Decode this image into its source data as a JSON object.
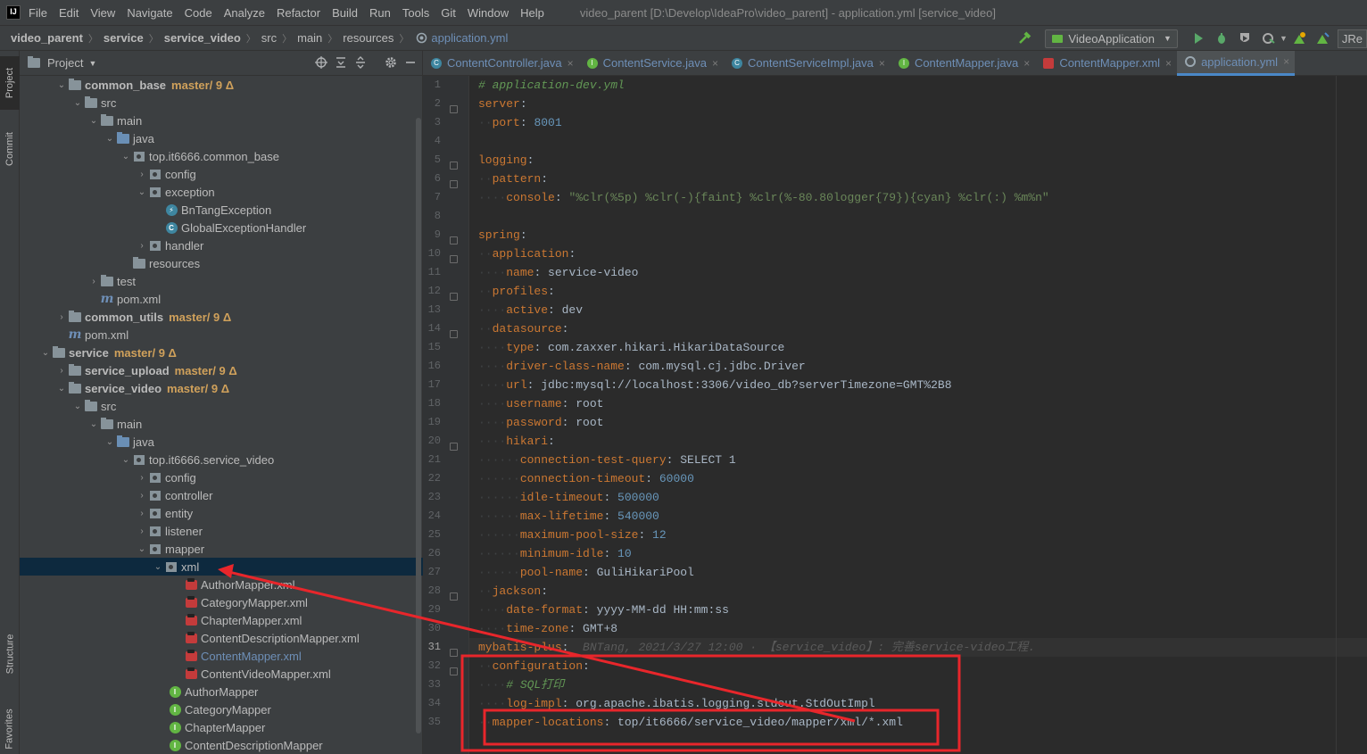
{
  "menubar": {
    "items": [
      "File",
      "Edit",
      "View",
      "Navigate",
      "Code",
      "Analyze",
      "Refactor",
      "Build",
      "Run",
      "Tools",
      "Git",
      "Window",
      "Help"
    ],
    "window_title": "video_parent [D:\\Develop\\IdeaPro\\video_parent] - application.yml [service_video]"
  },
  "navbar": {
    "breadcrumbs": [
      "video_parent",
      "service",
      "service_video",
      "src",
      "main",
      "resources",
      "application.yml"
    ],
    "run_config": "VideoApplication",
    "jre_label": "JRe"
  },
  "left_strip": {
    "project": "Project",
    "commit": "Commit",
    "structure": "Structure",
    "favorites": "Favorites"
  },
  "project_panel": {
    "title": "Project",
    "tree": [
      {
        "name": "common_base",
        "vcs": "master/ 9 Δ"
      },
      {
        "name": "src"
      },
      {
        "name": "main"
      },
      {
        "name": "java"
      },
      {
        "name": "top.it6666.common_base"
      },
      {
        "name": "config"
      },
      {
        "name": "exception"
      },
      {
        "name": "BnTangException"
      },
      {
        "name": "GlobalExceptionHandler"
      },
      {
        "name": "handler"
      },
      {
        "name": "resources"
      },
      {
        "name": "test"
      },
      {
        "name": "pom.xml"
      },
      {
        "name": "common_utils",
        "vcs": "master/ 9 Δ"
      },
      {
        "name": "pom.xml"
      },
      {
        "name": "service",
        "vcs": "master/ 9 Δ"
      },
      {
        "name": "service_upload",
        "vcs": "master/ 9 Δ"
      },
      {
        "name": "service_video",
        "vcs": "master/ 9 Δ"
      },
      {
        "name": "src"
      },
      {
        "name": "main"
      },
      {
        "name": "java"
      },
      {
        "name": "top.it6666.service_video"
      },
      {
        "name": "config"
      },
      {
        "name": "controller"
      },
      {
        "name": "entity"
      },
      {
        "name": "listener"
      },
      {
        "name": "mapper"
      },
      {
        "name": "xml"
      },
      {
        "name": "AuthorMapper.xml"
      },
      {
        "name": "CategoryMapper.xml"
      },
      {
        "name": "ChapterMapper.xml"
      },
      {
        "name": "ContentDescriptionMapper.xml"
      },
      {
        "name": "ContentMapper.xml"
      },
      {
        "name": "ContentVideoMapper.xml"
      },
      {
        "name": "AuthorMapper"
      },
      {
        "name": "CategoryMapper"
      },
      {
        "name": "ChapterMapper"
      },
      {
        "name": "ContentDescriptionMapper"
      }
    ]
  },
  "editor": {
    "tabs": [
      "ContentController.java",
      "ContentService.java",
      "ContentServiceImpl.java",
      "ContentMapper.java",
      "ContentMapper.xml",
      "application.yml"
    ],
    "active_tab": "application.yml",
    "current_line": 31,
    "lines": [
      {
        "t": [
          [
            "c",
            "# application-dev.yml"
          ]
        ]
      },
      {
        "t": [
          [
            "k",
            "server"
          ],
          [
            "v",
            ":"
          ]
        ]
      },
      {
        "t": [
          [
            "d",
            "  "
          ],
          [
            "k",
            "port"
          ],
          [
            "v",
            ": "
          ],
          [
            "n",
            "8001"
          ]
        ]
      },
      {
        "t": []
      },
      {
        "t": [
          [
            "k",
            "logging"
          ],
          [
            "v",
            ":"
          ]
        ]
      },
      {
        "t": [
          [
            "d",
            "  "
          ],
          [
            "k",
            "pattern"
          ],
          [
            "v",
            ":"
          ]
        ]
      },
      {
        "t": [
          [
            "d",
            "    "
          ],
          [
            "k",
            "console"
          ],
          [
            "v",
            ": "
          ],
          [
            "s",
            "\"%clr(%5p) %clr(-){faint} %clr(%-80.80logger{79}){cyan} %clr(:) %m%n\""
          ]
        ]
      },
      {
        "t": []
      },
      {
        "t": [
          [
            "k",
            "spring"
          ],
          [
            "v",
            ":"
          ]
        ]
      },
      {
        "t": [
          [
            "d",
            "  "
          ],
          [
            "k",
            "application"
          ],
          [
            "v",
            ":"
          ]
        ]
      },
      {
        "t": [
          [
            "d",
            "    "
          ],
          [
            "k",
            "name"
          ],
          [
            "v",
            ": service-video"
          ]
        ]
      },
      {
        "t": [
          [
            "d",
            "  "
          ],
          [
            "k",
            "profiles"
          ],
          [
            "v",
            ":"
          ]
        ]
      },
      {
        "t": [
          [
            "d",
            "    "
          ],
          [
            "k",
            "active"
          ],
          [
            "v",
            ": dev"
          ]
        ]
      },
      {
        "t": [
          [
            "d",
            "  "
          ],
          [
            "k",
            "datasource"
          ],
          [
            "v",
            ":"
          ]
        ]
      },
      {
        "t": [
          [
            "d",
            "    "
          ],
          [
            "k",
            "type"
          ],
          [
            "v",
            ": "
          ],
          [
            "s2",
            "com.zaxxer.hikari.HikariDataSource"
          ]
        ]
      },
      {
        "t": [
          [
            "d",
            "    "
          ],
          [
            "k",
            "driver-class-name"
          ],
          [
            "v",
            ": "
          ],
          [
            "s2",
            "com.mysql.cj.jdbc.Driver"
          ]
        ]
      },
      {
        "t": [
          [
            "d",
            "    "
          ],
          [
            "k",
            "url"
          ],
          [
            "v",
            ": jdbc:mysql://localhost:3306/video_db?serverTimezone=GMT%2B8"
          ]
        ]
      },
      {
        "t": [
          [
            "d",
            "    "
          ],
          [
            "k",
            "username"
          ],
          [
            "v",
            ": root"
          ]
        ]
      },
      {
        "t": [
          [
            "d",
            "    "
          ],
          [
            "k",
            "password"
          ],
          [
            "v",
            ": root"
          ]
        ]
      },
      {
        "t": [
          [
            "d",
            "    "
          ],
          [
            "k",
            "hikari"
          ],
          [
            "v",
            ":"
          ]
        ]
      },
      {
        "t": [
          [
            "d",
            "      "
          ],
          [
            "k",
            "connection-test-query"
          ],
          [
            "v",
            ": SELECT 1"
          ]
        ]
      },
      {
        "t": [
          [
            "d",
            "      "
          ],
          [
            "k",
            "connection-timeout"
          ],
          [
            "v",
            ": "
          ],
          [
            "n",
            "60000"
          ]
        ]
      },
      {
        "t": [
          [
            "d",
            "      "
          ],
          [
            "k",
            "idle-timeout"
          ],
          [
            "v",
            ": "
          ],
          [
            "n",
            "500000"
          ]
        ]
      },
      {
        "t": [
          [
            "d",
            "      "
          ],
          [
            "k",
            "max-lifetime"
          ],
          [
            "v",
            ": "
          ],
          [
            "n",
            "540000"
          ]
        ]
      },
      {
        "t": [
          [
            "d",
            "      "
          ],
          [
            "k",
            "maximum-pool-size"
          ],
          [
            "v",
            ": "
          ],
          [
            "n",
            "12"
          ]
        ]
      },
      {
        "t": [
          [
            "d",
            "      "
          ],
          [
            "k",
            "minimum-idle"
          ],
          [
            "v",
            ": "
          ],
          [
            "n",
            "10"
          ]
        ]
      },
      {
        "t": [
          [
            "d",
            "      "
          ],
          [
            "k",
            "pool-name"
          ],
          [
            "v",
            ": GuliHikariPool"
          ]
        ]
      },
      {
        "t": [
          [
            "d",
            "  "
          ],
          [
            "k",
            "jackson"
          ],
          [
            "v",
            ":"
          ]
        ]
      },
      {
        "t": [
          [
            "d",
            "    "
          ],
          [
            "k",
            "date-format"
          ],
          [
            "v",
            ": yyyy-MM-dd HH:mm:ss"
          ]
        ]
      },
      {
        "t": [
          [
            "d",
            "    "
          ],
          [
            "k",
            "time-zone"
          ],
          [
            "v",
            ": GMT+8"
          ]
        ]
      },
      {
        "t": [
          [
            "k",
            "mybatis-plus"
          ],
          [
            "v",
            ":"
          ],
          [
            "b",
            "  BNTang, 2021/3/27 12:00 · 【service_video】: 完善service-video工程."
          ]
        ]
      },
      {
        "t": [
          [
            "d",
            "  "
          ],
          [
            "k",
            "configuration"
          ],
          [
            "v",
            ":"
          ]
        ]
      },
      {
        "t": [
          [
            "d",
            "    "
          ],
          [
            "c",
            "# SQL打印"
          ]
        ]
      },
      {
        "t": [
          [
            "d",
            "    "
          ],
          [
            "k",
            "log-impl"
          ],
          [
            "v",
            ": org.apache.ibatis.logging.stdout.StdOutImpl"
          ]
        ]
      },
      {
        "t": [
          [
            "d",
            "  "
          ],
          [
            "k",
            "mapper-locations"
          ],
          [
            "v",
            ": top/it6666/service_video/mapper/xml/*.xml"
          ]
        ]
      }
    ]
  },
  "colors": {
    "annotation": "#e8262b",
    "keyword": "#cc7832",
    "number": "#6897bb",
    "string": "#6a8759",
    "comment": "#629755"
  }
}
